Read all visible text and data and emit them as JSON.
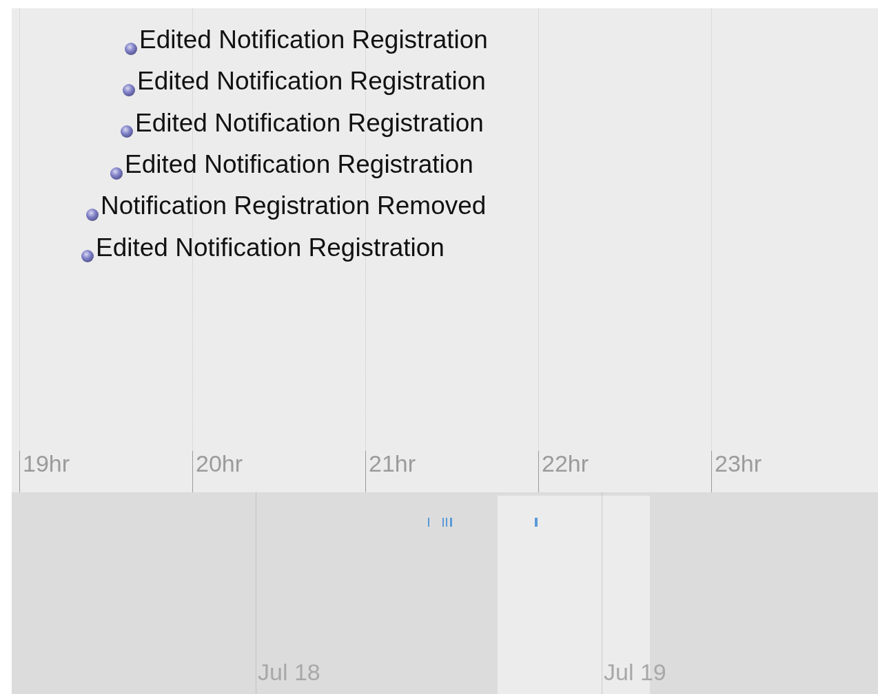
{
  "events": [
    {
      "title": "Edited Notification Registration"
    },
    {
      "title": "Edited Notification Registration"
    },
    {
      "title": "Edited Notification Registration"
    },
    {
      "title": "Edited Notification Registration"
    },
    {
      "title": "Notification Registration Removed"
    },
    {
      "title": "Edited Notification Registration"
    }
  ],
  "hour_labels": [
    "19hr",
    "20hr",
    "21hr",
    "22hr",
    "23hr"
  ],
  "day_labels": [
    "Jul 18",
    "Jul 19"
  ]
}
